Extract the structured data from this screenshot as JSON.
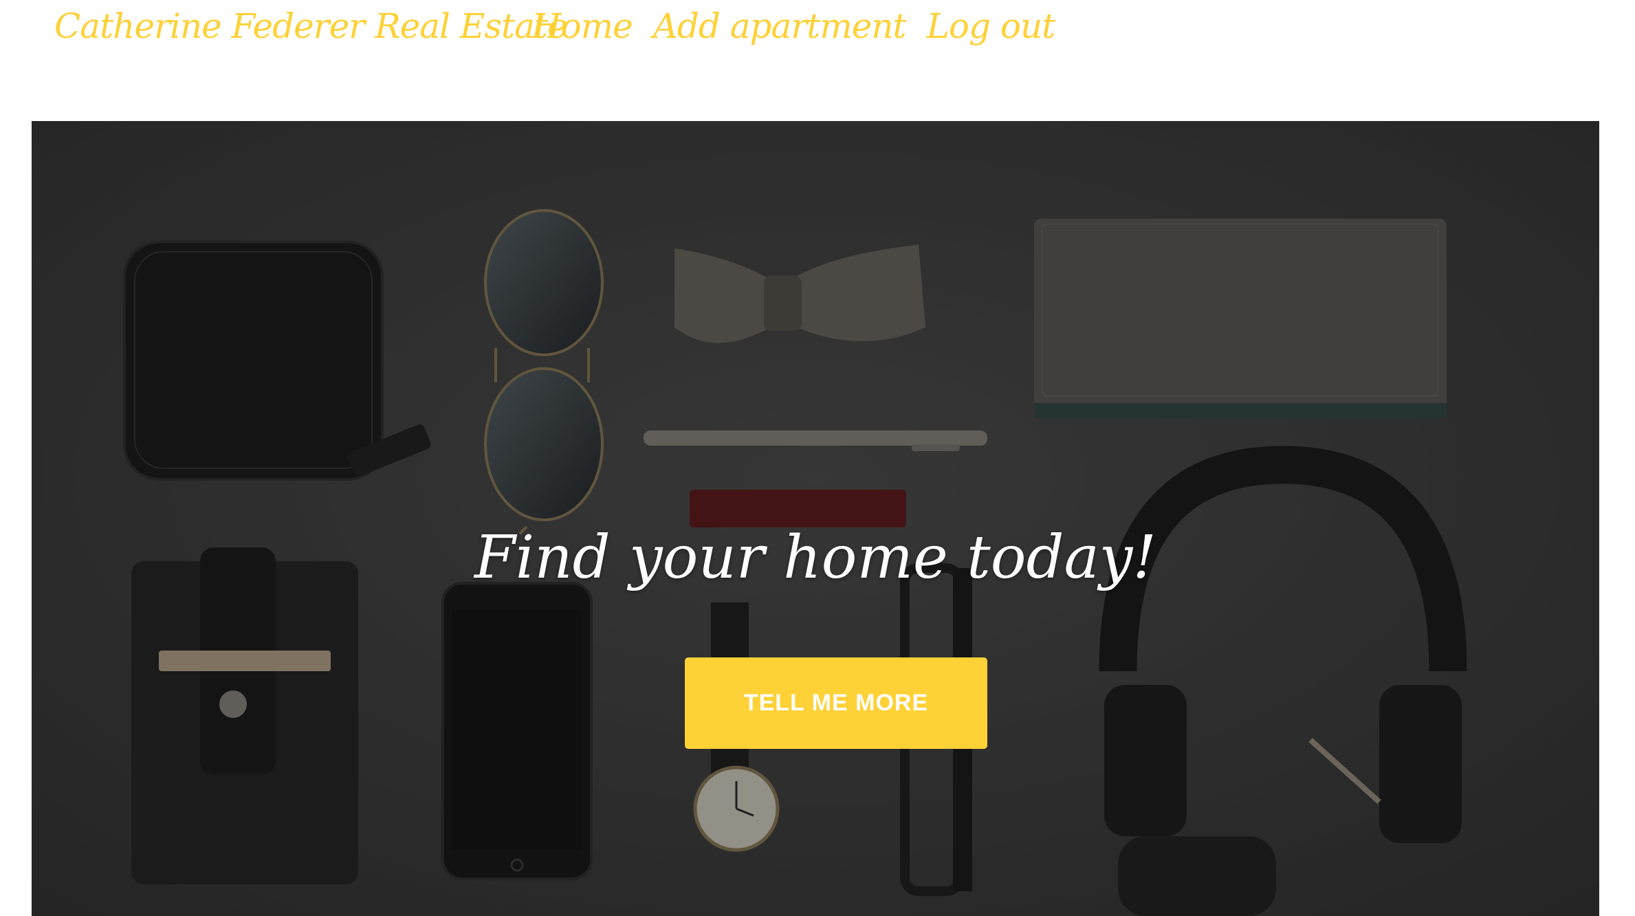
{
  "navbar": {
    "brand": "Catherine Federer Real Estate",
    "links": [
      {
        "label": "Home"
      },
      {
        "label": "Add apartment"
      },
      {
        "label": "Log out"
      }
    ]
  },
  "hero": {
    "heading": "Find your home today!",
    "button_label": "TELL ME MORE"
  },
  "colors": {
    "accent": "#fed136",
    "hero_background": "#3a3a3a",
    "heading_text": "#ffffff"
  },
  "icons": [
    "wallet-icon",
    "sunglasses-icon",
    "bow-tie-icon",
    "notebook-icon",
    "pen-icon",
    "lipstick-icon",
    "phone-case-icon",
    "smartphone-icon",
    "wristwatch-icon",
    "eyeglasses-icon",
    "headphones-icon"
  ]
}
